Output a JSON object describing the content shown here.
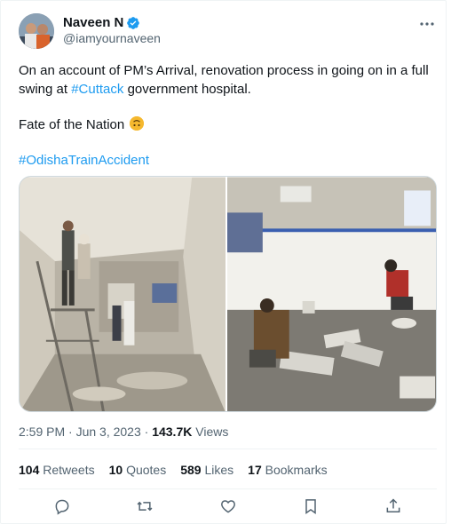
{
  "tweet": {
    "author_name": "Naveen N",
    "author_handle": "@iamyournaveen",
    "text_line1_a": "On an account of PM’s Arrival, renovation process in going on in a full swing at ",
    "text_line1_tag": "#Cuttack",
    "text_line1_b": " government hospital.",
    "text_line2": "Fate of the Nation ",
    "hashtag": "#OdishaTrainAccident",
    "time": "2:59 PM · Jun 3, 2023 · ",
    "views_count": "143.7K",
    "views_label": " Views"
  },
  "stats": {
    "retweets_count": "104",
    "retweets_label": " Retweets",
    "quotes_count": "10",
    "quotes_label": " Quotes",
    "likes_count": "589",
    "likes_label": " Likes",
    "bookmarks_count": "17",
    "bookmarks_label": " Bookmarks"
  },
  "icons": {
    "verified": "verified-badge-icon",
    "more": "more-icon",
    "reply": "reply-icon",
    "retweet": "retweet-icon",
    "like": "like-icon",
    "bookmark": "bookmark-icon",
    "share": "share-icon"
  },
  "colors": {
    "accent": "#1d9bf0",
    "text": "#0f1419",
    "secondary": "#536471"
  }
}
